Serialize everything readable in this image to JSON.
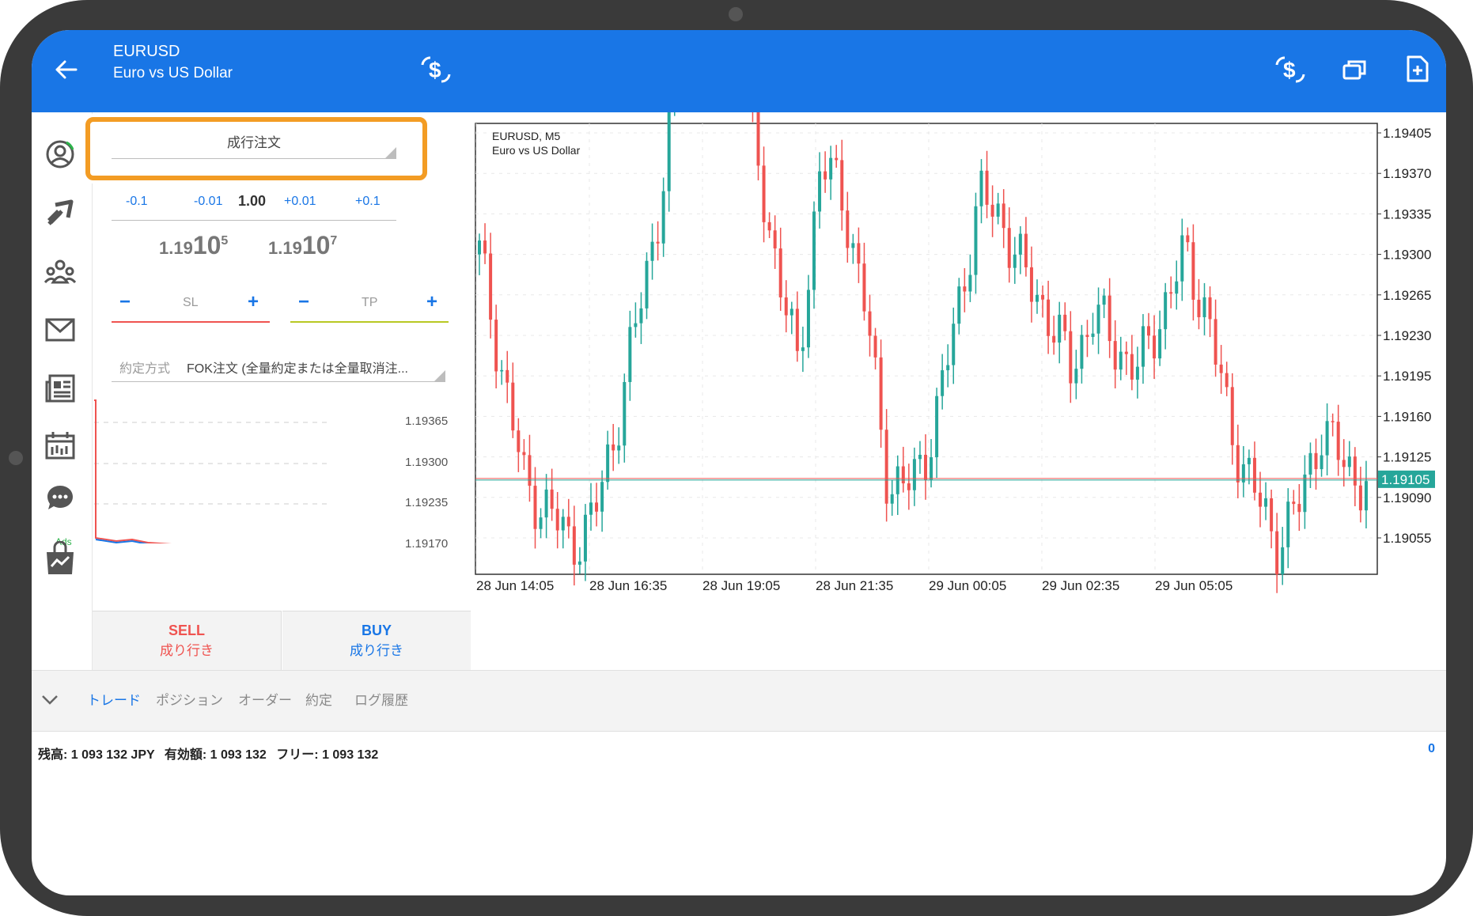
{
  "header": {
    "symbol": "EURUSD",
    "description": "Euro vs US Dollar",
    "icons": [
      "back-arrow-icon",
      "dollar-arrows-icon",
      "dollar-arrows-icon",
      "windows-icon",
      "add-document-icon"
    ]
  },
  "sidebar": {
    "icons": [
      "profile-icon",
      "trade-arrows-icon",
      "community-icon",
      "mail-icon",
      "news-icon",
      "calendar-icon",
      "chat-icon",
      "shop-bag-icon"
    ],
    "ads_label": "Ads"
  },
  "order_panel": {
    "order_type": "成行注文",
    "volume": {
      "minus_big": "-0.1",
      "minus_small": "-0.01",
      "value": "1.00",
      "plus_small": "+0.01",
      "plus_big": "+0.1"
    },
    "bid": {
      "main": "1.19",
      "big": "10",
      "sup": "5"
    },
    "ask": {
      "main": "1.19",
      "big": "10",
      "sup": "7"
    },
    "sl": {
      "minus": "−",
      "label": "SL",
      "plus": "+"
    },
    "tp": {
      "minus": "−",
      "label": "TP",
      "plus": "+"
    },
    "fill_policy_label": "約定方式",
    "fill_policy_value": "FOK注文 (全量約定または全量取消注...",
    "mini_chart_levels": [
      "1.19365",
      "1.19300",
      "1.19235",
      "1.19170"
    ],
    "sell": {
      "label": "SELL",
      "sub": "成り行き"
    },
    "buy": {
      "label": "BUY",
      "sub": "成り行き"
    }
  },
  "chart": {
    "title_line1": "EURUSD, M5",
    "title_line2": "Euro vs US Dollar",
    "price_labels": [
      "1.19405",
      "1.19370",
      "1.19335",
      "1.19300",
      "1.19265",
      "1.19230",
      "1.19195",
      "1.19160",
      "1.19125",
      "1.19090",
      "1.19055"
    ],
    "current_price": "1.19105",
    "time_labels": [
      "28 Jun 14:05",
      "28 Jun 16:35",
      "28 Jun 19:05",
      "28 Jun 21:35",
      "29 Jun 00:05",
      "29 Jun 02:35",
      "29 Jun 05:05"
    ],
    "colors": {
      "bull": "#26a69a",
      "bear": "#ef5350",
      "price_tag": "#26a69a"
    }
  },
  "tabs": {
    "items": [
      "トレード",
      "ポジション",
      "オーダー",
      "約定",
      "ログ履歴"
    ],
    "active": "トレード"
  },
  "account": {
    "balance_label": "残高:",
    "balance_value": "1 093 132 JPY",
    "equity_label": "有効額:",
    "equity_value": "1 093 132",
    "free_label": "フリー:",
    "free_value": "1 093 132",
    "right_value": "0"
  },
  "highlight_color": "#f39c24"
}
